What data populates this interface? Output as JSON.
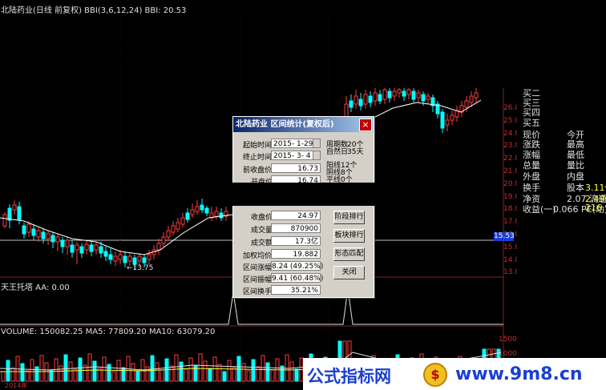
{
  "chart_header": {
    "title": "北陆药业(日线 前复权) BBI(3,6,12,24) BBI: 20.53",
    "sub_title": "天王托塔 AA: 0.00",
    "volume_title": "VOLUME: 150082.25  MA5: 77809.20  MA10: 63079.20",
    "low_annotation": "←13.75",
    "bottom_year": "2014年"
  },
  "colors": {
    "up": "#ff3c3c",
    "down": "#00ffff",
    "ma_line": "#ffffff",
    "accent_blue": "#1a3fd0"
  },
  "price_axis": {
    "labels": [
      "26.00",
      "25.00",
      "24.00",
      "23.00",
      "22.00",
      "21.00",
      "20.00",
      "19.00",
      "18.00",
      "17.00",
      "16.00",
      "15.00",
      "14.00",
      "13.00"
    ],
    "current": "15.53"
  },
  "volume_axis": {
    "labels": [
      "15000",
      "10000",
      "5000"
    ]
  },
  "quote_panel": {
    "rows": [
      {
        "l": "买二",
        "m": "",
        "r": ""
      },
      {
        "l": "买三",
        "m": "",
        "r": ""
      },
      {
        "l": "买四",
        "m": "",
        "r": ""
      },
      {
        "l": "买五",
        "m": "",
        "r": ""
      },
      {
        "l": "现价",
        "m": "今开",
        "r": ""
      },
      {
        "l": "涨跌",
        "m": "最高",
        "r": ""
      },
      {
        "l": "涨幅",
        "m": "最低",
        "r": ""
      },
      {
        "l": "总量",
        "m": "量比",
        "r": ""
      },
      {
        "l": "外盘",
        "m": "内盘",
        "r": ""
      },
      {
        "l": "换手",
        "m": "股本",
        "r": "3.11亿"
      },
      {
        "l": "净资",
        "m": "2.07 流通",
        "r": "2.49亿"
      },
      {
        "l": "收益(一)",
        "m": "0.066 PE(动)",
        "r": "216.9"
      }
    ]
  },
  "dialog": {
    "title": "北陆药业  区间统计(复权后)",
    "start_label": "起始时间",
    "start_value": "2015- 1-29",
    "end_label": "终止时间",
    "end_value": "2015- 3- 4",
    "periods_label": "周期数",
    "periods_value": "20个",
    "natural_label": "自然日",
    "natural_value": "35天",
    "prev_close_label": "前收盘价",
    "prev_close_value": "16.73",
    "open_label": "开盘价",
    "open_value": "16.74",
    "yang_label": "阳线",
    "yang_value": "12个",
    "yin_label": "阴线",
    "yin_value": "8个",
    "flat_label": "平线",
    "flat_value": "0个",
    "close_label": "收盘价",
    "close_value": "24.97",
    "volume_label": "成交量",
    "volume_value": "870900",
    "amount_label": "成交额",
    "amount_value": "17.3亿",
    "wavg_label": "加权均价",
    "wavg_value": "19.882",
    "rise_label": "区间涨幅",
    "rise_value": "8.24 (49.25%)",
    "amp_label": "区间振幅",
    "amp_value": "9.41 (60.48%)",
    "turnover_label": "区间换手",
    "turnover_value": "35.21%",
    "btn_stage_sort": "阶段排行",
    "btn_sector_sort": "板块排行",
    "btn_pattern": "形态匹配",
    "btn_close": "关闭"
  },
  "watermark": {
    "text": "公式指标网",
    "url": "www.9m8.cn"
  }
}
